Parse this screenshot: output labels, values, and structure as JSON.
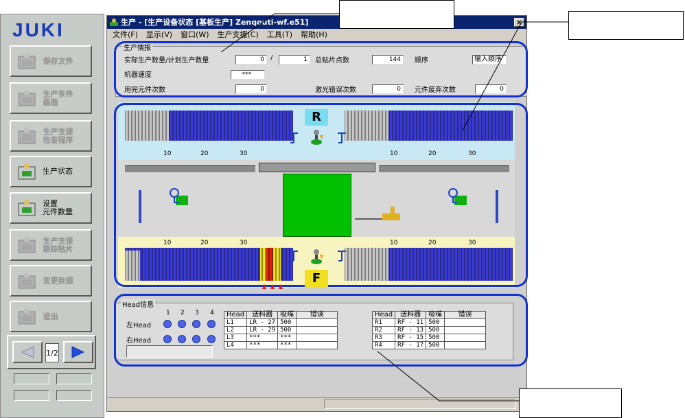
{
  "sidebar": {
    "logo": "JUKI",
    "buttons": [
      {
        "label": "保存文件",
        "enabled": false
      },
      {
        "label": "生产条件\n画面",
        "enabled": false
      },
      {
        "label": "生产支援\n检查程序",
        "enabled": false
      },
      {
        "label": "生产状态",
        "enabled": true
      },
      {
        "label": "设置\n元件数量",
        "enabled": true
      },
      {
        "label": "生产支援\n跟踪贴片",
        "enabled": false
      },
      {
        "label": "变更数据",
        "enabled": false
      },
      {
        "label": "退出",
        "enabled": false
      }
    ],
    "page_indicator": "1/2"
  },
  "window": {
    "title": "生产 - [生产设备状态 [基板生产] Zenqouti-wf.e51]",
    "menu": [
      "文件(F)",
      "显示(V)",
      "窗口(W)",
      "生产支援(C)",
      "工具(T)",
      "帮助(H)"
    ],
    "close": "×"
  },
  "production_info": {
    "group_label": "生产情报",
    "actual_plan_label": "实际生产数量/计划生产数量",
    "actual": "0",
    "slash": "/",
    "plan": "1",
    "total_points_label": "总贴片点数",
    "total_points": "144",
    "order_label": "顺序",
    "order_value": "输入顺序",
    "speed_label": "机器速度",
    "speed_value": "***",
    "used_up_label": "用完元件次数",
    "used_up": "0",
    "laser_err_label": "激光错误次数",
    "laser_err": "0",
    "discard_label": "元件废弃次数",
    "discard": "0"
  },
  "machine": {
    "rear_label": "R",
    "front_label": "F",
    "ticks": [
      "10",
      "20",
      "30"
    ],
    "colors": {
      "feeder_blue": "#3a3ad8",
      "board_green": "#00c000",
      "rear_bg": "#c8e8f4",
      "front_bg": "#f8f4c0"
    }
  },
  "head_info": {
    "group_label": "Head信息",
    "nums": [
      "1",
      "2",
      "3",
      "4"
    ],
    "left_label": "左Head",
    "right_label": "右Head",
    "left_table": {
      "headers": [
        "Head",
        "送料器",
        "吸嘴",
        "错误"
      ],
      "rows": [
        [
          "L1",
          "LR - 27",
          "500",
          ""
        ],
        [
          "L2",
          "LR - 29",
          "500",
          ""
        ],
        [
          "L3",
          "***",
          "***",
          ""
        ],
        [
          "L4",
          "***",
          "***",
          ""
        ]
      ]
    },
    "right_table": {
      "headers": [
        "Head",
        "送料器",
        "吸嘴",
        "错误"
      ],
      "rows": [
        [
          "R1",
          "RF - 11",
          "500",
          ""
        ],
        [
          "R2",
          "RF - 13",
          "500",
          ""
        ],
        [
          "R3",
          "RF - 15",
          "500",
          ""
        ],
        [
          "R4",
          "RF - 17",
          "500",
          ""
        ]
      ]
    }
  }
}
